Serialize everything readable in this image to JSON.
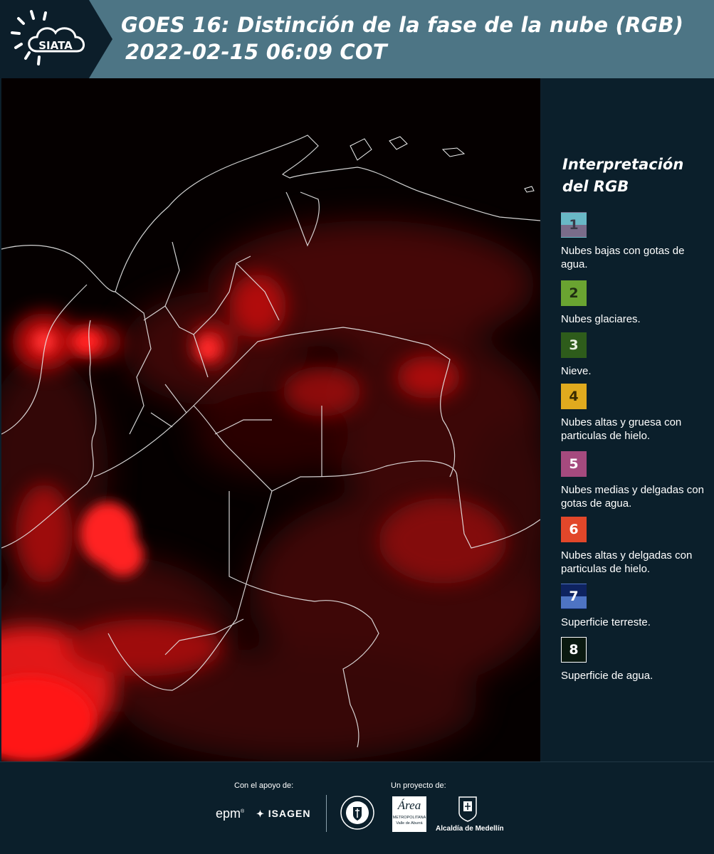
{
  "header": {
    "logo_text": "SIATA",
    "title_line1": "GOES 16: Distinción de la fase de la nube (RGB)",
    "title_line2": "2022-02-15 06:09 COT"
  },
  "legend": {
    "title_line1": "Interpretación",
    "title_line2": "del RGB",
    "items": [
      {
        "number": "1",
        "description": "Nubes bajas con gotas de agua.",
        "color_top": "#69b8c6",
        "color_bottom": "#7a6c8a",
        "text_color": "#3a3a48"
      },
      {
        "number": "2",
        "description": "Nubes glaciares.",
        "color_top": "#6aa431",
        "color_bottom": "#6aa431",
        "text_color": "#1f2e12"
      },
      {
        "number": "3",
        "description": "Nieve.",
        "color_top": "#2e5c1b",
        "color_bottom": "#2e5c1b",
        "text_color": "#e8f0e0"
      },
      {
        "number": "4",
        "description": "Nubes altas y gruesa con particulas de hielo.",
        "color_top": "#e0aa1e",
        "color_bottom": "#e0aa1e",
        "text_color": "#3a2a00"
      },
      {
        "number": "5",
        "description": "Nubes medias y delgadas con gotas de agua.",
        "color_top": "#a54a7e",
        "color_bottom": "#a54a7e",
        "text_color": "#ffffff"
      },
      {
        "number": "6",
        "description": "Nubes altas y delgadas con particulas de hielo.",
        "color_top": "#e2472a",
        "color_bottom": "#e2472a",
        "text_color": "#ffffff"
      },
      {
        "number": "7",
        "description": "Superficie terreste.",
        "color_top": "#0e2360",
        "color_bottom": "#4e74c4",
        "text_color": "#ffffff"
      },
      {
        "number": "8",
        "description": "Superficie de agua.",
        "color_top": "#0a1910",
        "color_bottom": "#0a1910",
        "text_color": "#ffffff"
      }
    ]
  },
  "footer": {
    "support_label": "Con el apoyo de:",
    "project_label": "Un proyecto de:",
    "epm_text": "epm",
    "isagen_text": "ISAGEN",
    "area_title": "Área",
    "area_sub1": "METROPOLITANA",
    "area_sub2": "Valle de Aburrá",
    "alcaldia_text": "Alcaldía de Medellín"
  },
  "colors": {
    "header_bg": "#4d7585",
    "panel_bg": "#0b1f2b",
    "cloud_red": "#ff1a1a"
  }
}
